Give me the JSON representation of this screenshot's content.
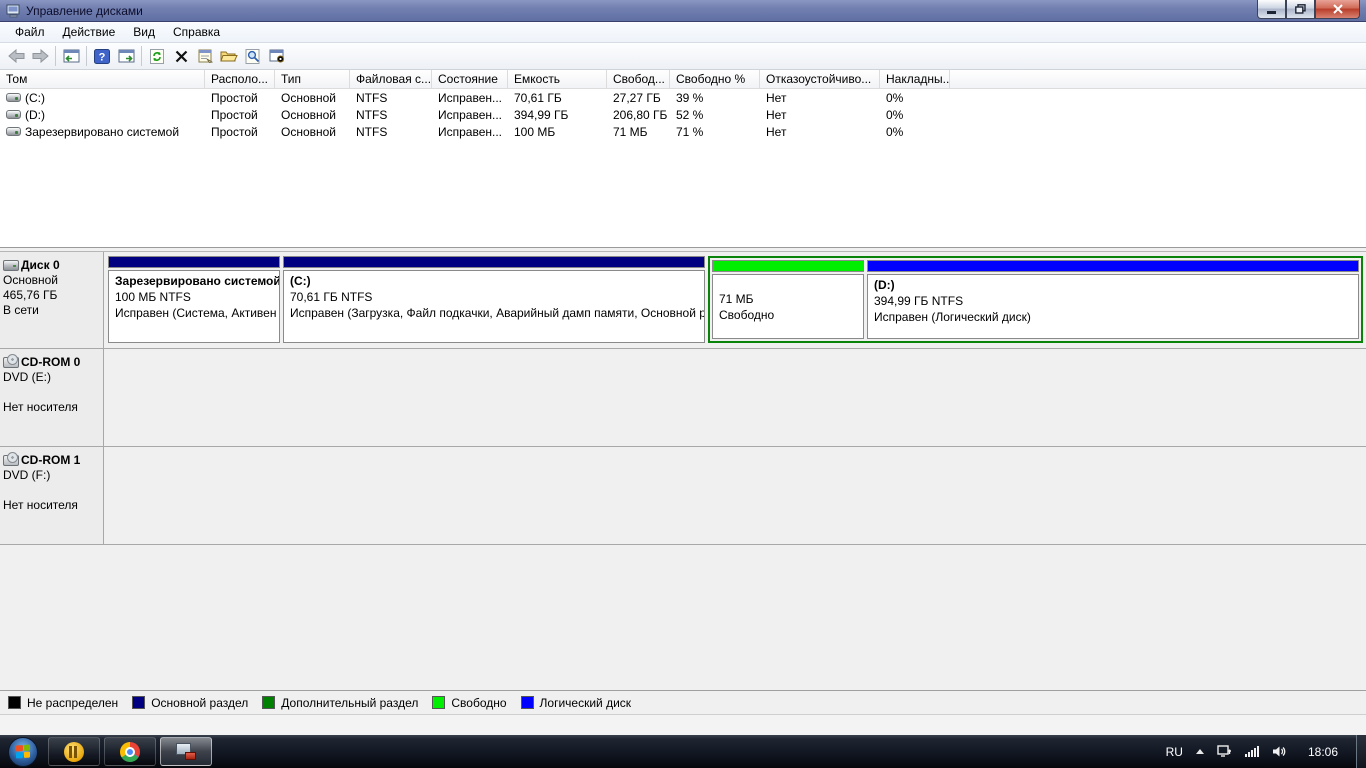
{
  "window": {
    "title": "Управление дисками",
    "controls": {
      "minimize": "–",
      "restore": "❐",
      "close": "✕"
    }
  },
  "menu": {
    "file": "Файл",
    "action": "Действие",
    "view": "Вид",
    "help": "Справка"
  },
  "toolbar_icons": [
    "back",
    "forward",
    "show-console-tree",
    "help",
    "show-action-pane",
    "refresh",
    "delete",
    "properties",
    "open",
    "search",
    "configure"
  ],
  "volume_table": {
    "columns": [
      "Том",
      "Располо...",
      "Тип",
      "Файловая с...",
      "Состояние",
      "Емкость",
      "Свобод...",
      "Свободно %",
      "Отказоустойчиво...",
      "Накладны..."
    ],
    "rows": [
      {
        "volume": "(C:)",
        "layout": "Простой",
        "type": "Основной",
        "fs": "NTFS",
        "status": "Исправен...",
        "capacity": "70,61 ГБ",
        "free": "27,27 ГБ",
        "free_pct": "39 %",
        "fault_tolerance": "Нет",
        "overhead": "0%"
      },
      {
        "volume": "(D:)",
        "layout": "Простой",
        "type": "Основной",
        "fs": "NTFS",
        "status": "Исправен...",
        "capacity": "394,99 ГБ",
        "free": "206,80 ГБ",
        "free_pct": "52 %",
        "fault_tolerance": "Нет",
        "overhead": "0%"
      },
      {
        "volume": "Зарезервировано системой",
        "layout": "Простой",
        "type": "Основной",
        "fs": "NTFS",
        "status": "Исправен...",
        "capacity": "100 МБ",
        "free": "71 МБ",
        "free_pct": "71 %",
        "fault_tolerance": "Нет",
        "overhead": "0%"
      }
    ]
  },
  "disk0": {
    "name": "Диск 0",
    "type": "Основной",
    "size": "465,76 ГБ",
    "status": "В сети",
    "partitions": {
      "system_reserved": {
        "title": "Зарезервировано системой",
        "size_fs": "100 МБ NTFS",
        "status": "Исправен (Система, Активен",
        "color": "#000080"
      },
      "c": {
        "title": "(C:)",
        "size_fs": "70,61 ГБ NTFS",
        "status": "Исправен (Загрузка, Файл подкачки, Аварийный дамп памяти, Основной р",
        "color": "#000080"
      },
      "free": {
        "size": "71 МБ",
        "status": "Свободно",
        "color": "#00ee00"
      },
      "d": {
        "title": "(D:)",
        "size_fs": "394,99 ГБ NTFS",
        "status": "Исправен (Логический диск)",
        "color": "#0000ff"
      }
    },
    "extended_border_color": "#0a830a"
  },
  "cdrom0": {
    "name": "CD-ROM 0",
    "drive": "DVD (E:)",
    "media": "Нет носителя"
  },
  "cdrom1": {
    "name": "CD-ROM 1",
    "drive": "DVD (F:)",
    "media": "Нет носителя"
  },
  "legend": {
    "items": [
      {
        "label": "Не распределен",
        "color": "#000000"
      },
      {
        "label": "Основной раздел",
        "color": "#000080"
      },
      {
        "label": "Дополнительный раздел",
        "color": "#008000"
      },
      {
        "label": "Свободно",
        "color": "#00ee00"
      },
      {
        "label": "Логический диск",
        "color": "#0000ff"
      }
    ]
  },
  "taskbar": {
    "language": "RU",
    "time": "18:06",
    "apps": [
      "messenger",
      "chrome",
      "disk-management"
    ]
  }
}
